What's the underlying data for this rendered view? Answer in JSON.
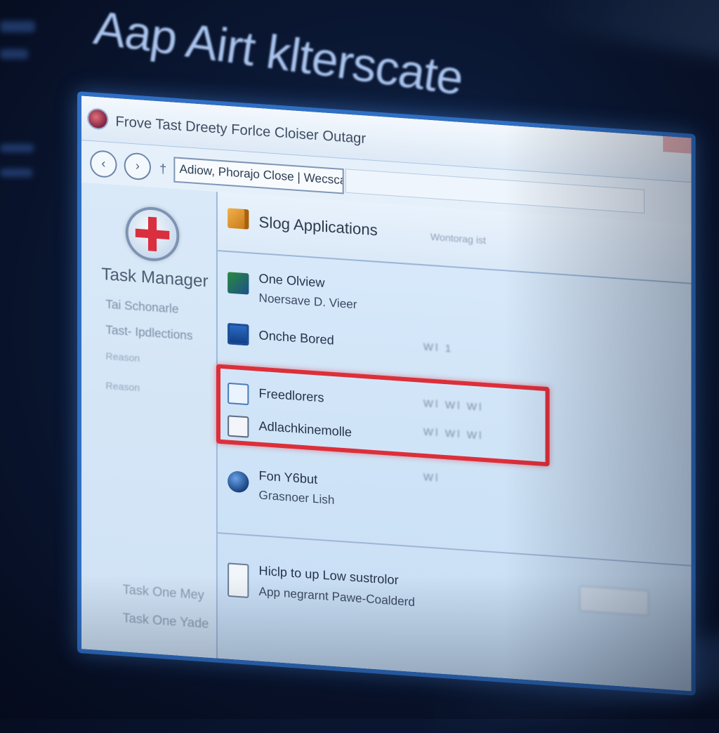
{
  "background": {
    "title": "Aap Airt klterscate",
    "accent": "#2f6fc4"
  },
  "window": {
    "title": "Frove Tast Dreety Forlce Cloiser Outagr",
    "icon": "app-icon"
  },
  "toolbar": {
    "back_icon": "back-icon",
    "forward_icon": "forward-icon",
    "address_value": "Adiow, Phorajo Close | Wecscate"
  },
  "sidebar": {
    "logo_icon": "red-cross-shield-icon",
    "title": "Task Manager",
    "links": [
      "Tai Schonarle",
      "Tast- Ipdlections"
    ],
    "faint_items": [
      "Reason",
      "Reason"
    ],
    "footer_items": [
      "Task One Mey",
      "Task One Yade"
    ]
  },
  "content": {
    "section_title": "Slog Applications",
    "section_aux": "Wontorag ist",
    "rows": [
      {
        "name": "One Olview",
        "sub": "Noersave D. Vieer",
        "icon": "app-green-icon",
        "value": ""
      },
      {
        "name": "Onche Bored",
        "sub": "",
        "icon": "app-blue-icon",
        "value": "Wl 1"
      },
      {
        "name": "Freedlorers",
        "sub": "",
        "icon": "document-icon",
        "value": "Wl Wl Wl"
      },
      {
        "name": "Adlachkinemolle",
        "sub": "",
        "icon": "video-icon",
        "value": "Wl Wl Wl"
      },
      {
        "name": "Fon Y6but",
        "sub": "Grasnoer Lish",
        "icon": "globe-icon",
        "value": "Wl"
      }
    ],
    "help": {
      "line1": "Hiclp to up Low sustrolor",
      "line2": "App negrarnt Pawe-Coalderd",
      "icon": "help-document-icon"
    },
    "highlight_color": "#dc2f3a"
  }
}
